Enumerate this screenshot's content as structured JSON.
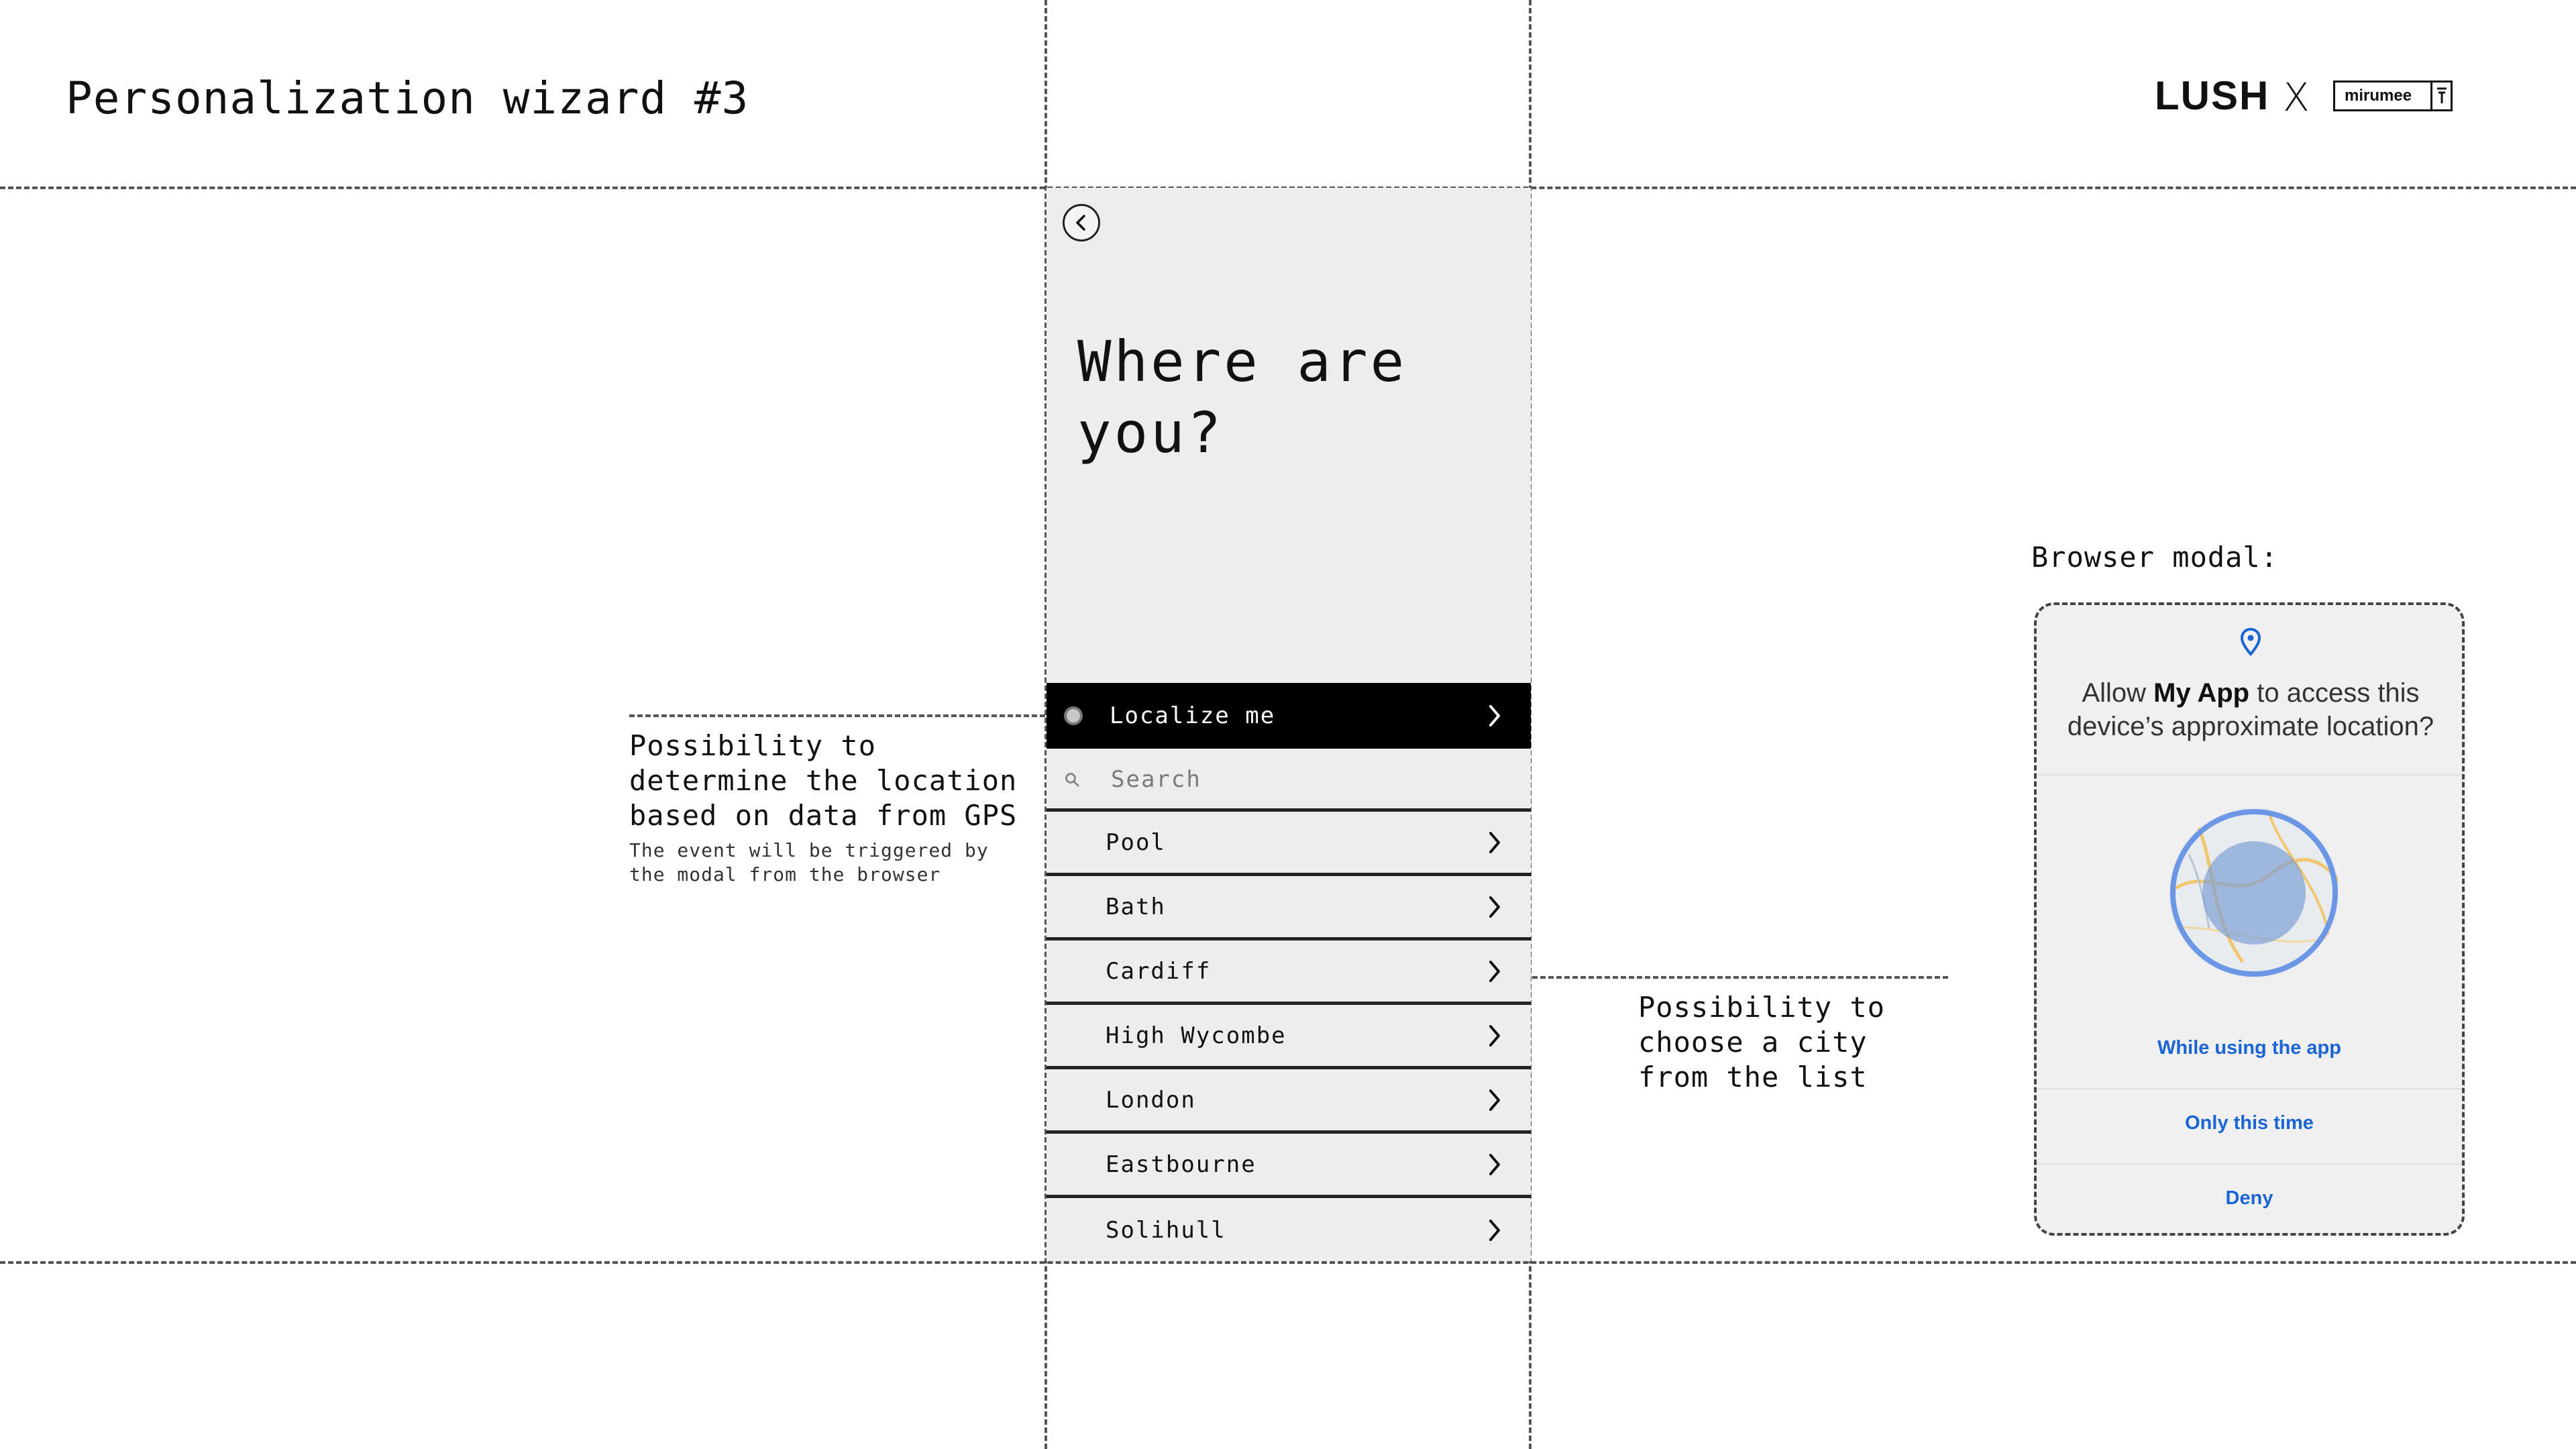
{
  "page": {
    "title": "Personalization wizard #3"
  },
  "logos": {
    "lush": "LUSH",
    "separator": "X",
    "mirumee": "mirumee"
  },
  "phone": {
    "heading": "Where are you?",
    "localize_label": "Localize me",
    "search_placeholder": "Search",
    "cities": [
      "Pool",
      "Bath",
      "Cardiff",
      "High Wycombe",
      "London",
      "Eastbourne",
      "Solihull"
    ]
  },
  "annotations": {
    "gps_title": "Possibility to determine the location based on data from GPS",
    "gps_note": "The event will be triggered by the modal from the browser",
    "list_title": "Possibility to choose a city from the list",
    "modal_label": "Browser modal:"
  },
  "browser_modal": {
    "question_prefix": "Allow",
    "app_name": "My App",
    "question_suffix": "to access this device’s approximate location?",
    "options": [
      "While using the app",
      "Only this time",
      "Deny"
    ],
    "accent_color": "#1a65d6"
  }
}
